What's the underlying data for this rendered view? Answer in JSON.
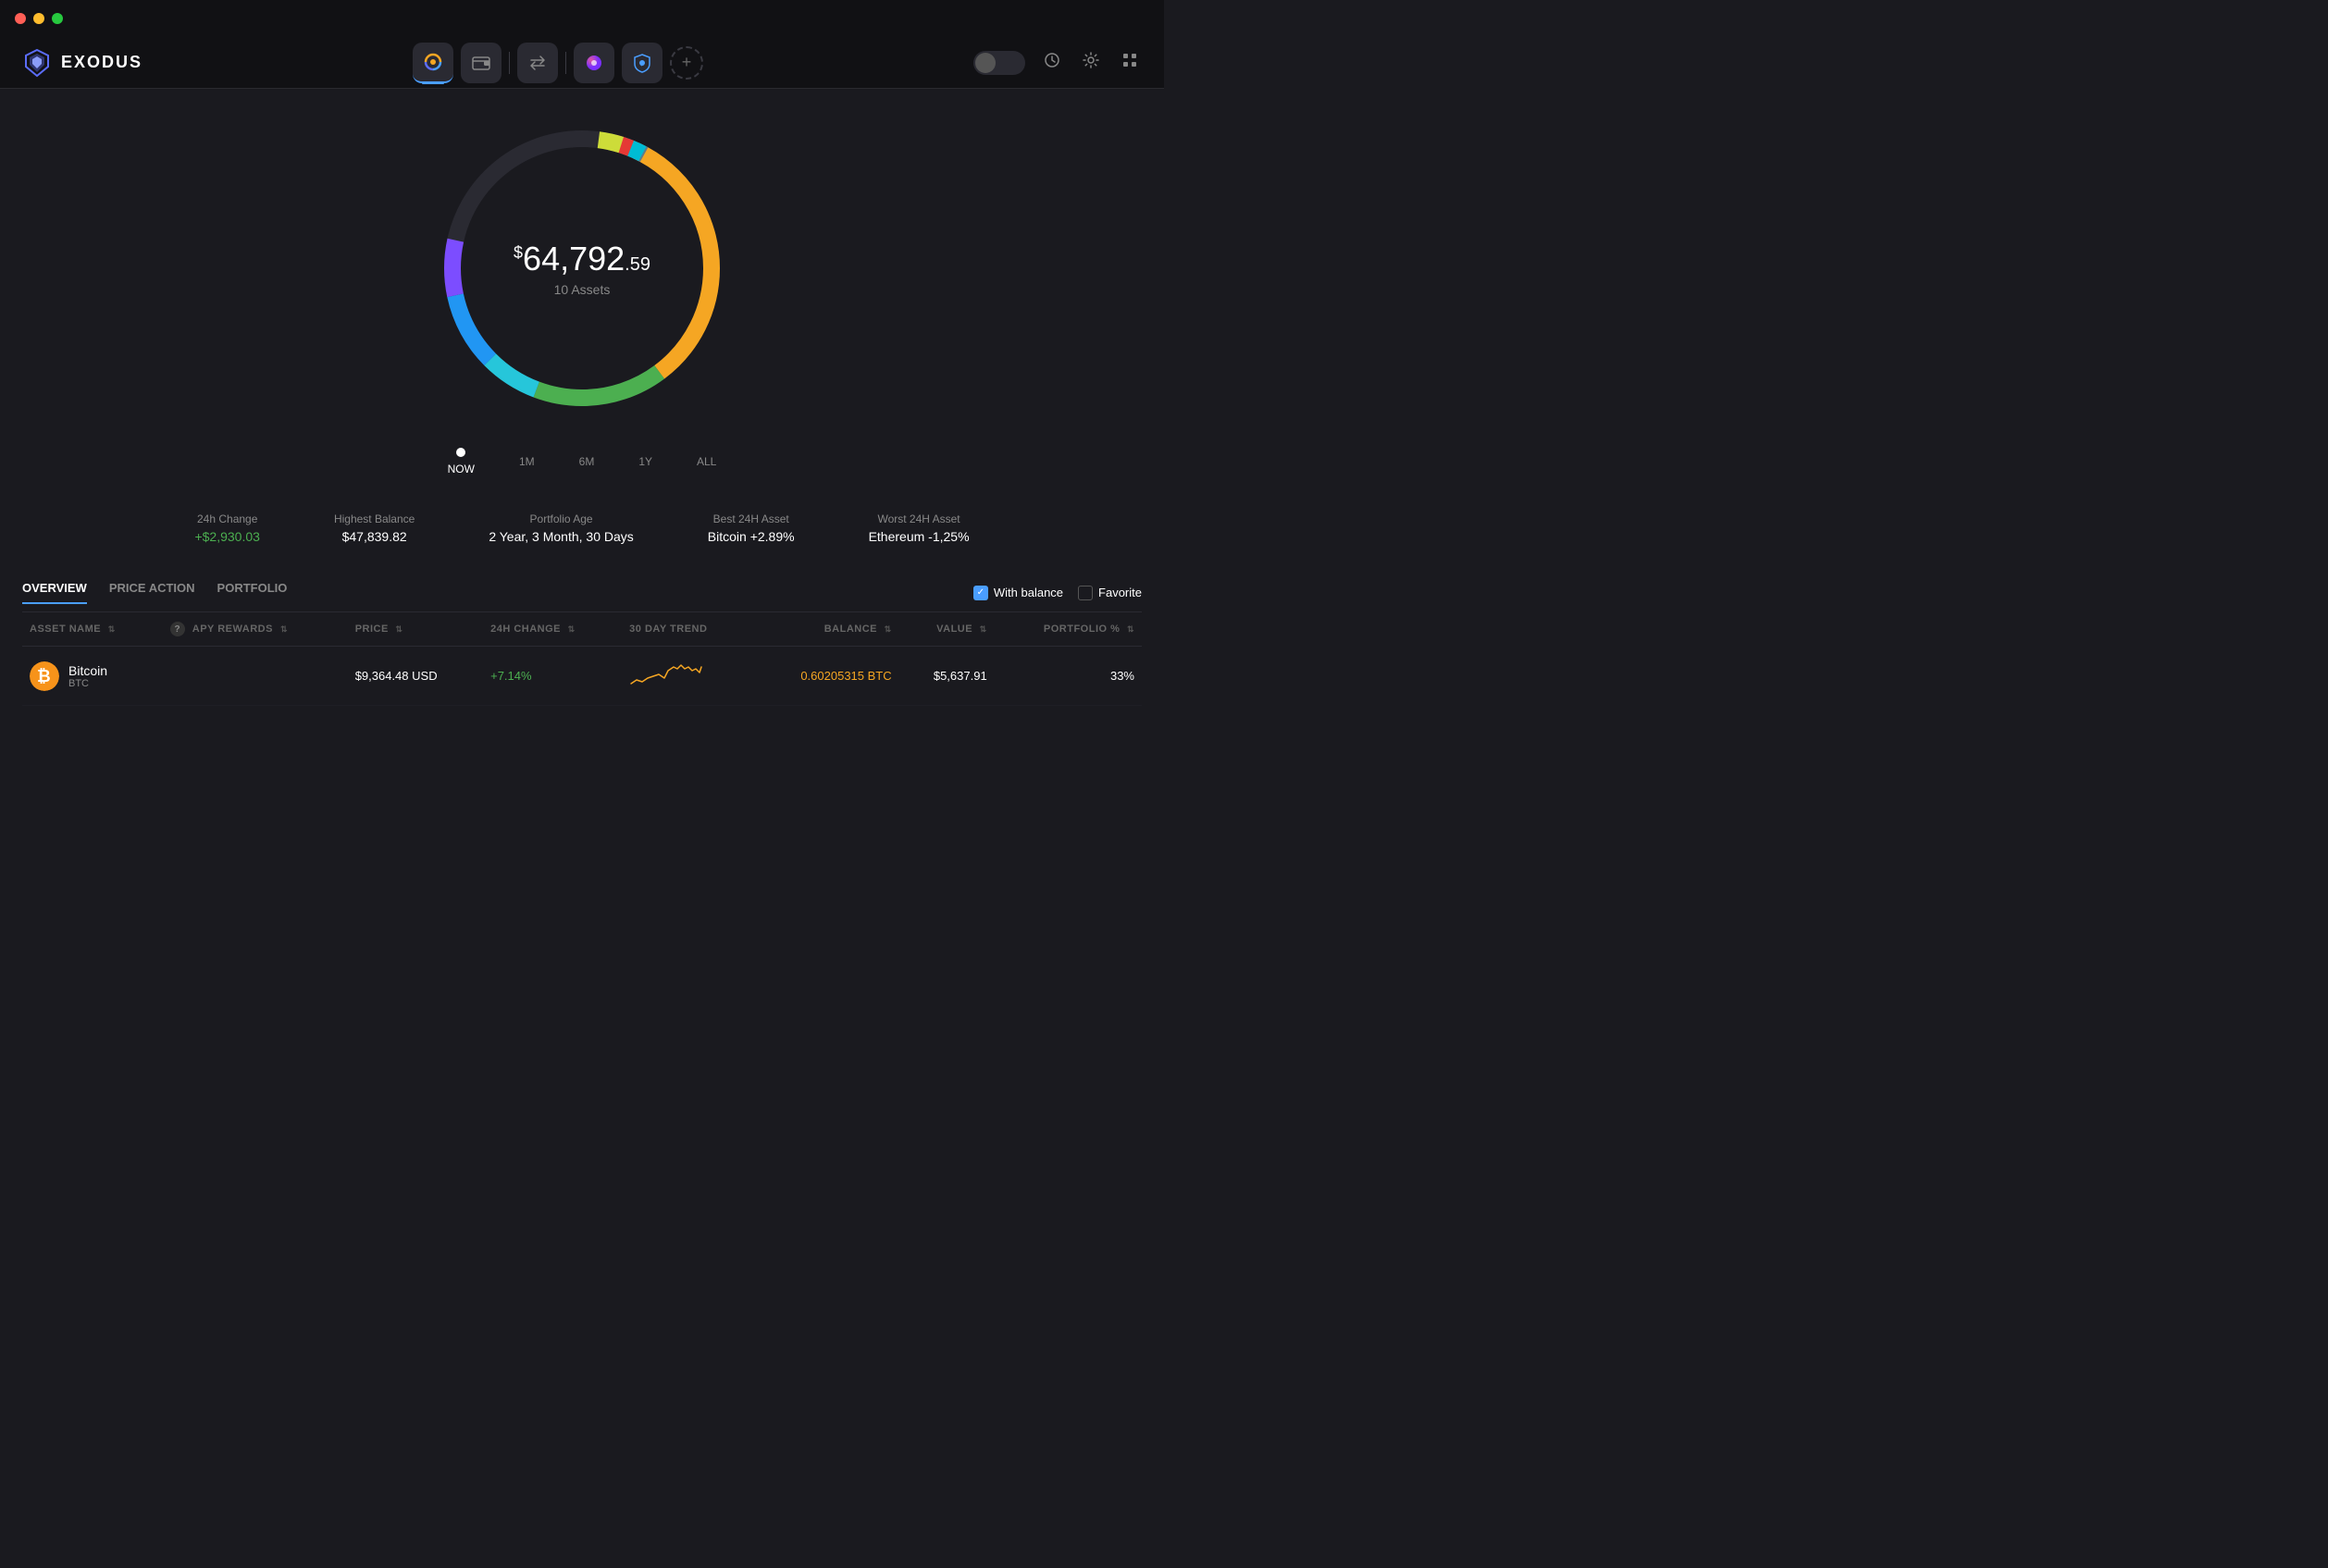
{
  "titlebar": {
    "dots": [
      "red",
      "yellow",
      "green"
    ]
  },
  "topnav": {
    "logo": {
      "text": "EXODUS"
    },
    "nav_buttons": [
      {
        "id": "portfolio",
        "active": true,
        "icon": "◎"
      },
      {
        "id": "wallet",
        "active": false,
        "icon": "▣"
      },
      {
        "id": "exchange",
        "active": false,
        "icon": "⇄"
      },
      {
        "id": "apps",
        "active": false,
        "icon": "⬡"
      },
      {
        "id": "security",
        "active": false,
        "icon": "⬡"
      }
    ],
    "add_label": "+",
    "right_icons": {
      "lock": "🔒",
      "history": "🕐",
      "settings": "⚙",
      "grid": "⊞"
    }
  },
  "portfolio": {
    "amount_prefix": "$",
    "amount_main": "64,792",
    "amount_cents": ".59",
    "assets_count": "10 Assets"
  },
  "timeline": [
    {
      "label": "NOW",
      "active": true
    },
    {
      "label": "1M",
      "active": false
    },
    {
      "label": "6M",
      "active": false
    },
    {
      "label": "1Y",
      "active": false
    },
    {
      "label": "ALL",
      "active": false
    }
  ],
  "stats": [
    {
      "label": "24h Change",
      "value": "+$2,930.03",
      "positive": true
    },
    {
      "label": "Highest Balance",
      "value": "$47,839.82",
      "positive": false
    },
    {
      "label": "Portfolio Age",
      "value": "2 Year, 3 Month, 30 Days",
      "positive": false
    },
    {
      "label": "Best 24H Asset",
      "value": "Bitcoin +2.89%",
      "positive": false
    },
    {
      "label": "Worst 24H Asset",
      "value": "Ethereum -1,25%",
      "positive": false
    }
  ],
  "tabs": [
    {
      "label": "OVERVIEW",
      "active": true
    },
    {
      "label": "PRICE ACTION",
      "active": false
    },
    {
      "label": "PORTFOLIO",
      "active": false
    }
  ],
  "filters": [
    {
      "label": "With balance",
      "checked": true
    },
    {
      "label": "Favorite",
      "checked": false
    }
  ],
  "table": {
    "columns": [
      {
        "label": "ASSET NAME",
        "sortable": true
      },
      {
        "label": "APY REWARDS",
        "sortable": true,
        "has_help": true
      },
      {
        "label": "PRICE",
        "sortable": true
      },
      {
        "label": "24H CHANGE",
        "sortable": true
      },
      {
        "label": "30 DAY TREND",
        "sortable": false
      },
      {
        "label": "BALANCE",
        "sortable": true
      },
      {
        "label": "VALUE",
        "sortable": true
      },
      {
        "label": "PORTFOLIO %",
        "sortable": true
      }
    ],
    "rows": [
      {
        "name": "Bitcoin",
        "ticker": "BTC",
        "color": "#f7931a",
        "apy": "",
        "price": "$9,364.48 USD",
        "change": "+7.14%",
        "change_positive": true,
        "balance": "0.60205315 BTC",
        "value": "$5,637.91",
        "portfolio_pct": "33%",
        "trend_positive": true
      }
    ]
  }
}
